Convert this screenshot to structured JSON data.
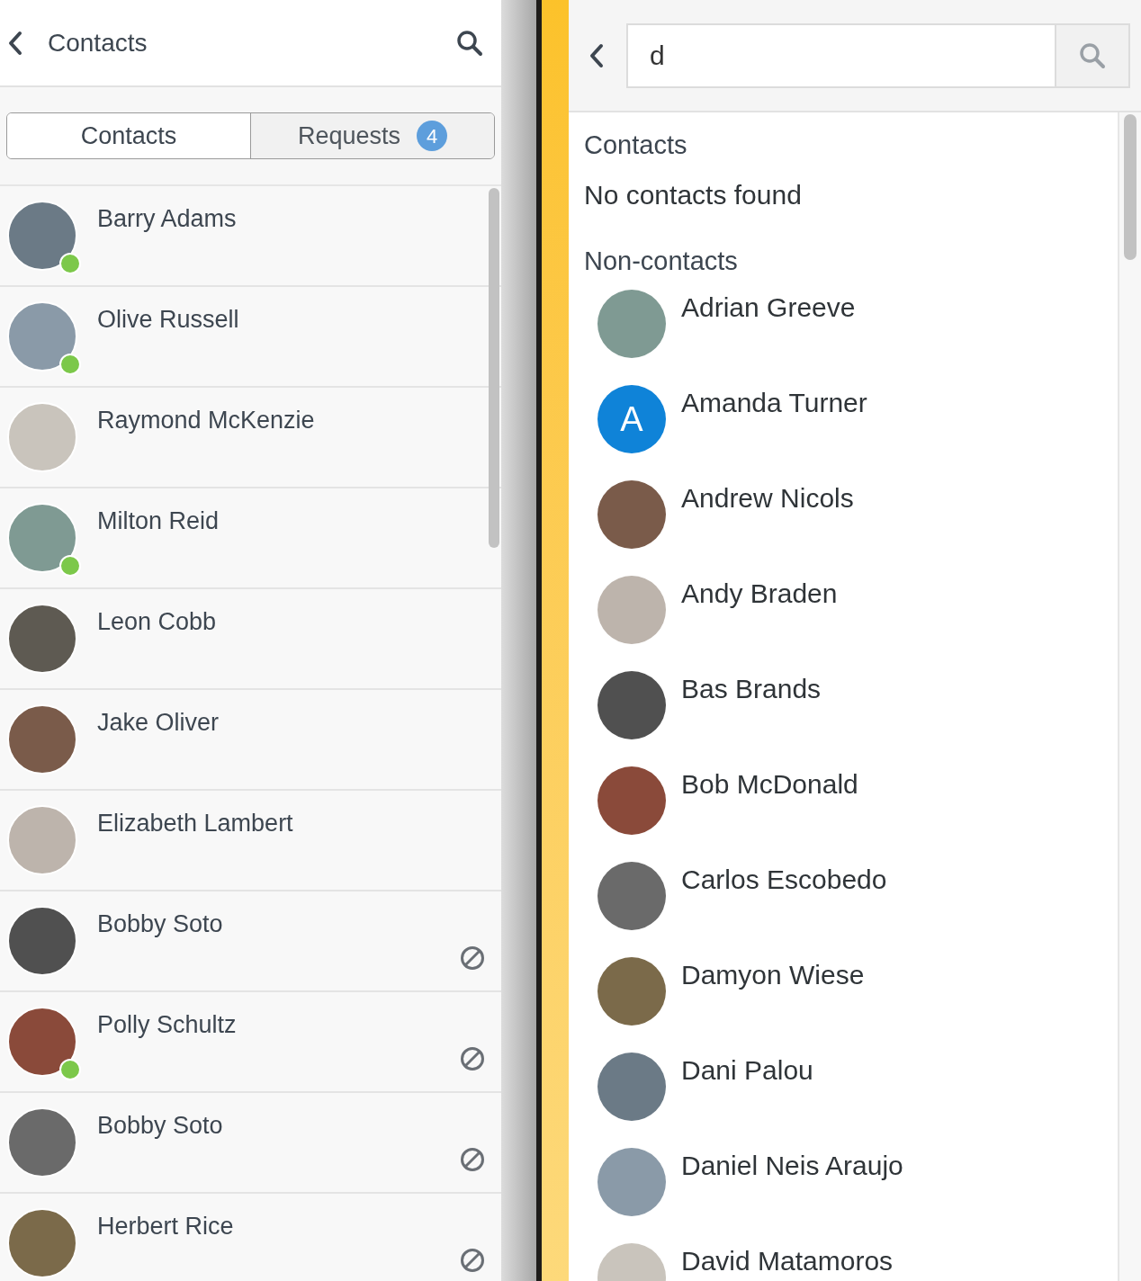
{
  "left_header": {
    "title": "Contacts"
  },
  "tabs": [
    {
      "label": "Contacts",
      "selected": true
    },
    {
      "label": "Requests",
      "selected": false,
      "badge": "4"
    }
  ],
  "contacts": [
    {
      "name": "Barry Adams",
      "online": true,
      "blocked": false
    },
    {
      "name": "Olive Russell",
      "online": true,
      "blocked": false
    },
    {
      "name": "Raymond McKenzie",
      "online": false,
      "blocked": false
    },
    {
      "name": "Milton Reid",
      "online": true,
      "blocked": false
    },
    {
      "name": "Leon Cobb",
      "online": false,
      "blocked": false
    },
    {
      "name": "Jake Oliver",
      "online": false,
      "blocked": false
    },
    {
      "name": "Elizabeth Lambert",
      "online": false,
      "blocked": false
    },
    {
      "name": "Bobby Soto",
      "online": false,
      "blocked": true
    },
    {
      "name": "Polly Schultz",
      "online": true,
      "blocked": true
    },
    {
      "name": "Bobby Soto",
      "online": false,
      "blocked": true
    },
    {
      "name": "Herbert Rice",
      "online": false,
      "blocked": true
    }
  ],
  "search": {
    "value": "d"
  },
  "results": {
    "contacts_heading": "Contacts",
    "contacts_empty": "No contacts found",
    "noncontacts_heading": "Non-contacts",
    "noncontacts": [
      {
        "name": "Adrian Greeve",
        "kind": "photo"
      },
      {
        "name": "Amanda Turner",
        "kind": "letter",
        "initial": "A"
      },
      {
        "name": "Andrew Nicols",
        "kind": "photo"
      },
      {
        "name": "Andy Braden",
        "kind": "photo"
      },
      {
        "name": "Bas Brands",
        "kind": "photo"
      },
      {
        "name": "Bob McDonald",
        "kind": "photo"
      },
      {
        "name": "Carlos Escobedo",
        "kind": "photo"
      },
      {
        "name": "Damyon Wiese",
        "kind": "photo"
      },
      {
        "name": "Dani Palou",
        "kind": "photo"
      },
      {
        "name": "Daniel Neis Araujo",
        "kind": "photo"
      },
      {
        "name": "David Matamoros",
        "kind": "photo"
      }
    ]
  }
}
